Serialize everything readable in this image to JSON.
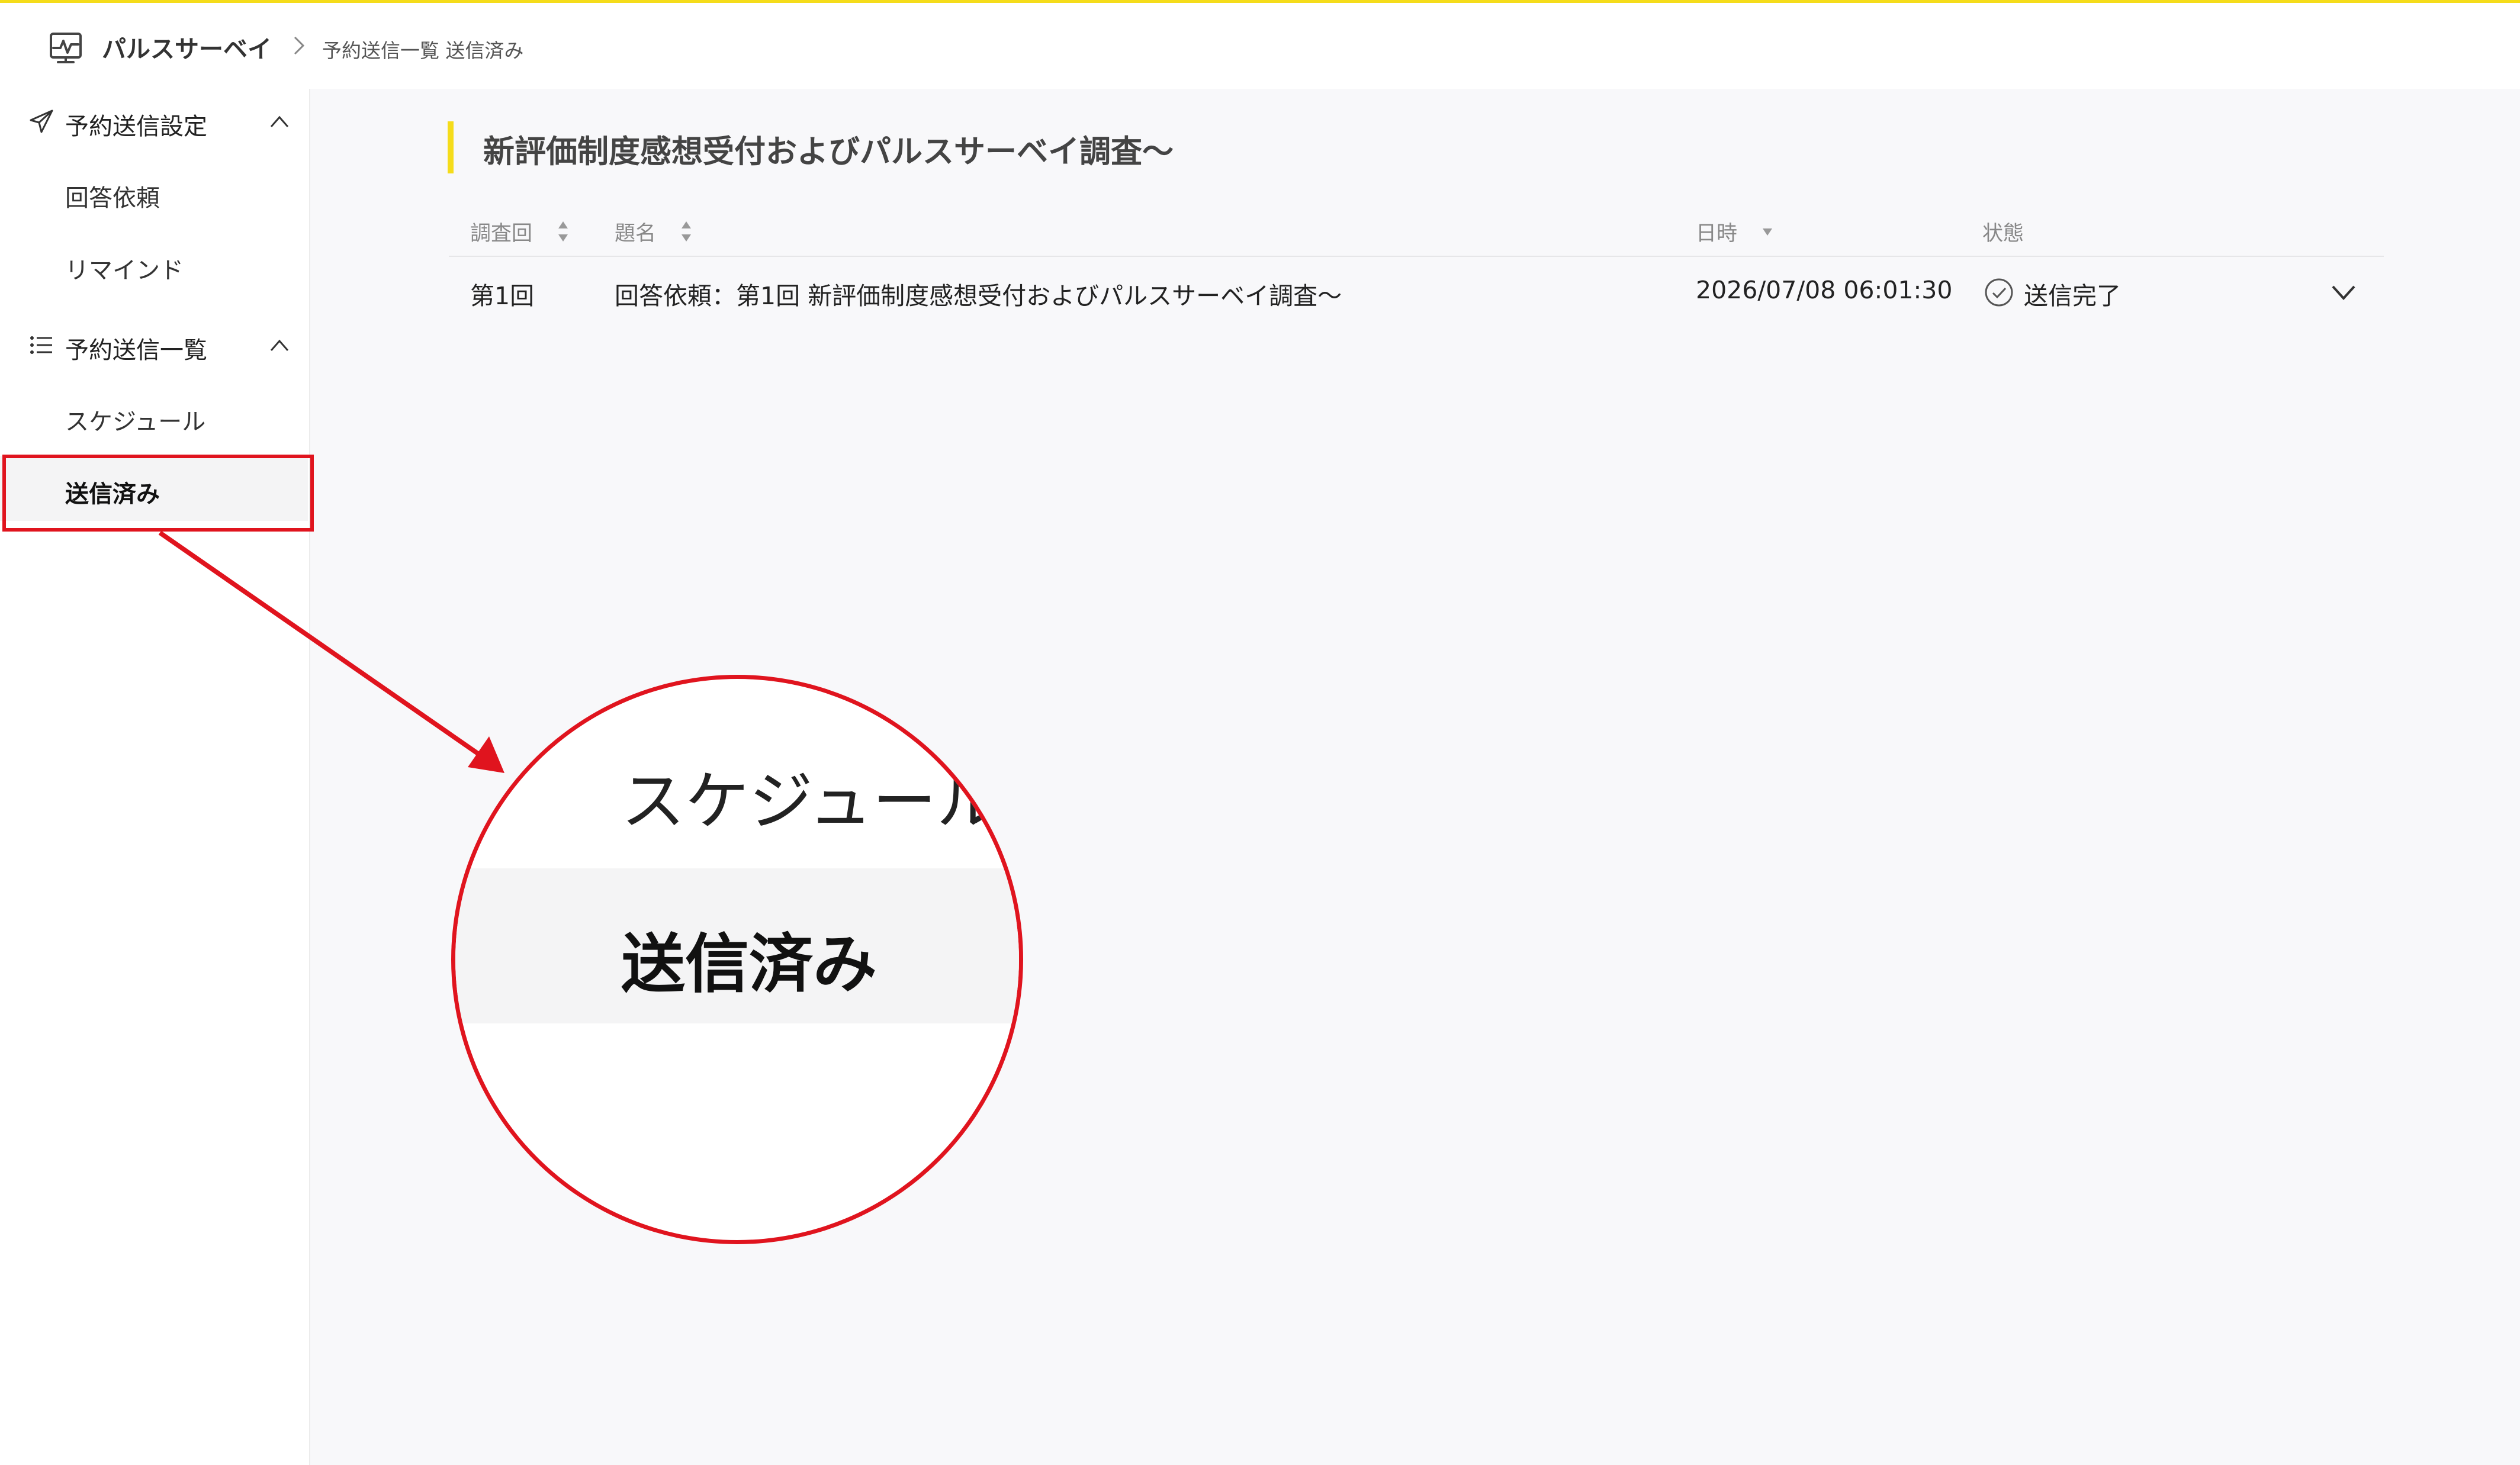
{
  "header": {
    "app_name": "パルスサーベイ",
    "breadcrumb": "予約送信一覧 送信済み",
    "accent_color": "#f5dc1a"
  },
  "sidebar": {
    "groups": [
      {
        "label": "予約送信設定",
        "icon": "paper-plane-icon",
        "expanded": true,
        "items": [
          {
            "label": "回答依頼",
            "active": false
          },
          {
            "label": "リマインド",
            "active": false
          }
        ]
      },
      {
        "label": "予約送信一覧",
        "icon": "list-icon",
        "expanded": true,
        "items": [
          {
            "label": "スケジュール",
            "active": false
          },
          {
            "label": "送信済み",
            "active": true
          }
        ]
      }
    ]
  },
  "main": {
    "title": "新評価制度感想受付およびパルスサーベイ調査〜",
    "table": {
      "columns": [
        "調査回",
        "題名",
        "日時",
        "状態"
      ],
      "rows": [
        {
          "round": "第1回",
          "subject": "回答依頼：第1回 新評価制度感想受付およびパルスサーベイ調査〜",
          "datetime": "2026/07/08 06:01:30",
          "status": "送信完了"
        }
      ]
    }
  },
  "annotation": {
    "color": "#e0141e",
    "magnified_item_label": "スケジュール",
    "magnified_active_label": "送信済み"
  }
}
